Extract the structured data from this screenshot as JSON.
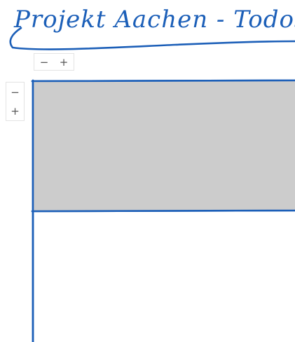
{
  "title": "Projekt Aachen - Todos",
  "zoom_horizontal": {
    "minus_label": "−",
    "plus_label": "+"
  },
  "zoom_vertical": {
    "minus_label": "−",
    "plus_label": "+"
  },
  "colors": {
    "ink": "#1c5fb8",
    "block": "#cccccc",
    "background": "#ffffff"
  }
}
